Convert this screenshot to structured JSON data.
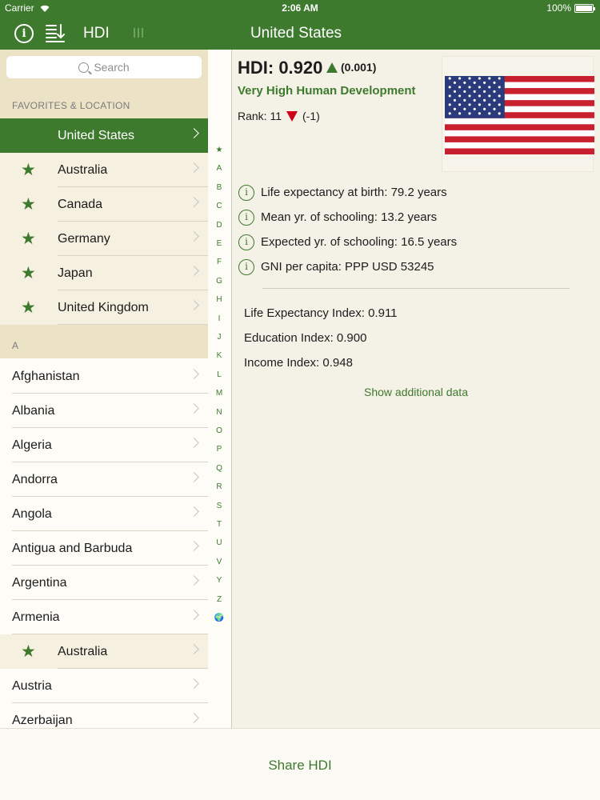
{
  "status_bar": {
    "carrier": "Carrier",
    "time": "2:06 AM",
    "battery": "100%"
  },
  "nav": {
    "hdi_label": "HDI",
    "title": "United States",
    "info_icon": "i"
  },
  "search": {
    "placeholder": "Search"
  },
  "sections": {
    "favorites": "FAVORITES & LOCATION",
    "a": "A"
  },
  "favorites": [
    {
      "label": "United States",
      "starred": false,
      "selected": true
    },
    {
      "label": "Australia",
      "starred": true
    },
    {
      "label": "Canada",
      "starred": true
    },
    {
      "label": "Germany",
      "starred": true
    },
    {
      "label": "Japan",
      "starred": true
    },
    {
      "label": "United Kingdom",
      "starred": true
    }
  ],
  "countries": [
    {
      "label": "Afghanistan",
      "starred": false
    },
    {
      "label": "Albania",
      "starred": false
    },
    {
      "label": "Algeria",
      "starred": false
    },
    {
      "label": "Andorra",
      "starred": false
    },
    {
      "label": "Angola",
      "starred": false
    },
    {
      "label": "Antigua and Barbuda",
      "starred": false
    },
    {
      "label": "Argentina",
      "starred": false
    },
    {
      "label": "Armenia",
      "starred": false
    },
    {
      "label": "Australia",
      "starred": true
    },
    {
      "label": "Austria",
      "starred": false
    },
    {
      "label": "Azerbaijan",
      "starred": false
    }
  ],
  "index_letters": [
    "★",
    "A",
    "B",
    "C",
    "D",
    "E",
    "F",
    "G",
    "H",
    "I",
    "J",
    "K",
    "L",
    "M",
    "N",
    "O",
    "P",
    "Q",
    "R",
    "S",
    "T",
    "U",
    "V",
    "Y",
    "Z",
    "🌍"
  ],
  "detail": {
    "hdi": "HDI: 0.920",
    "hdi_change": "(0.001)",
    "category": "Very High Human Development",
    "rank_label": "Rank: 11",
    "rank_change": "(-1)",
    "facts": [
      "Life expectancy at birth: 79.2 years",
      "Mean yr. of schooling: 13.2 years",
      "Expected yr. of schooling: 16.5 years",
      "GNI per capita: PPP USD 53245"
    ],
    "indices": [
      "Life Expectancy Index: 0.911",
      "Education Index: 0.900",
      "Income Index: 0.948"
    ],
    "show_more": "Show additional data"
  },
  "toolbar": {
    "share_label": "Share HDI"
  },
  "colors": {
    "brand_green": "#3e7a2e",
    "decline_red": "#d0021b",
    "background": "#f4f1e6"
  },
  "icons": [
    "info-icon",
    "sort-icon",
    "columns-icon",
    "search-icon",
    "star-icon",
    "chevron-right-icon",
    "triangle-up-icon",
    "triangle-down-icon",
    "info-circle-icon",
    "flag-usa-icon"
  ]
}
